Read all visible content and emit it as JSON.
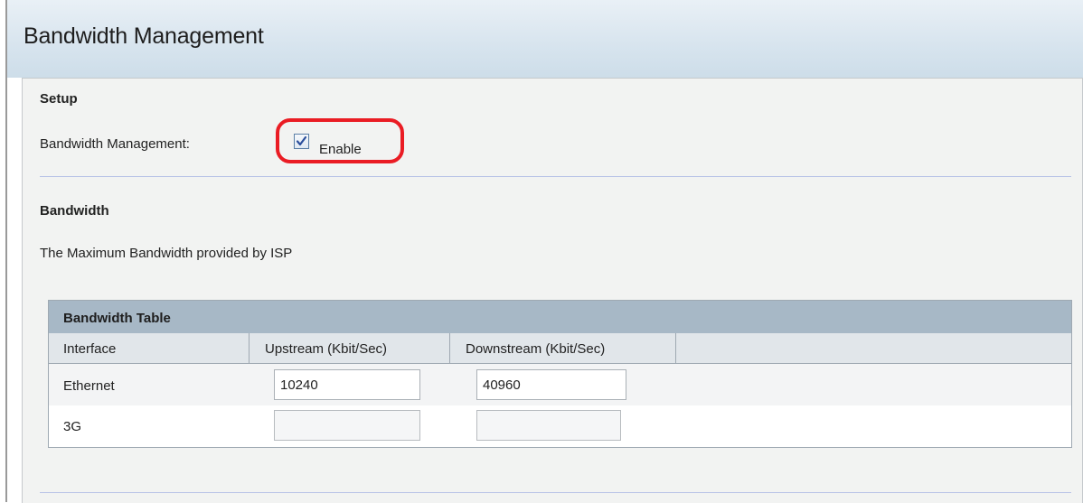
{
  "page": {
    "title": "Bandwidth Management"
  },
  "setup": {
    "heading": "Setup",
    "bandwidth_management_label": "Bandwidth Management:",
    "enable_label": "Enable",
    "enable_checked": true
  },
  "bandwidth": {
    "heading": "Bandwidth",
    "description": "The Maximum Bandwidth provided by ISP"
  },
  "table": {
    "title": "Bandwidth Table",
    "columns": [
      "Interface",
      "Upstream (Kbit/Sec)",
      "Downstream (Kbit/Sec)"
    ],
    "rows": [
      {
        "interface": "Ethernet",
        "upstream": "10240",
        "downstream": "40960"
      },
      {
        "interface": "3G",
        "upstream": "",
        "downstream": ""
      }
    ]
  },
  "colors": {
    "highlight": "#ea1c24",
    "table_header": "#a7b8c6",
    "title_bar": "#d7e4ee"
  }
}
